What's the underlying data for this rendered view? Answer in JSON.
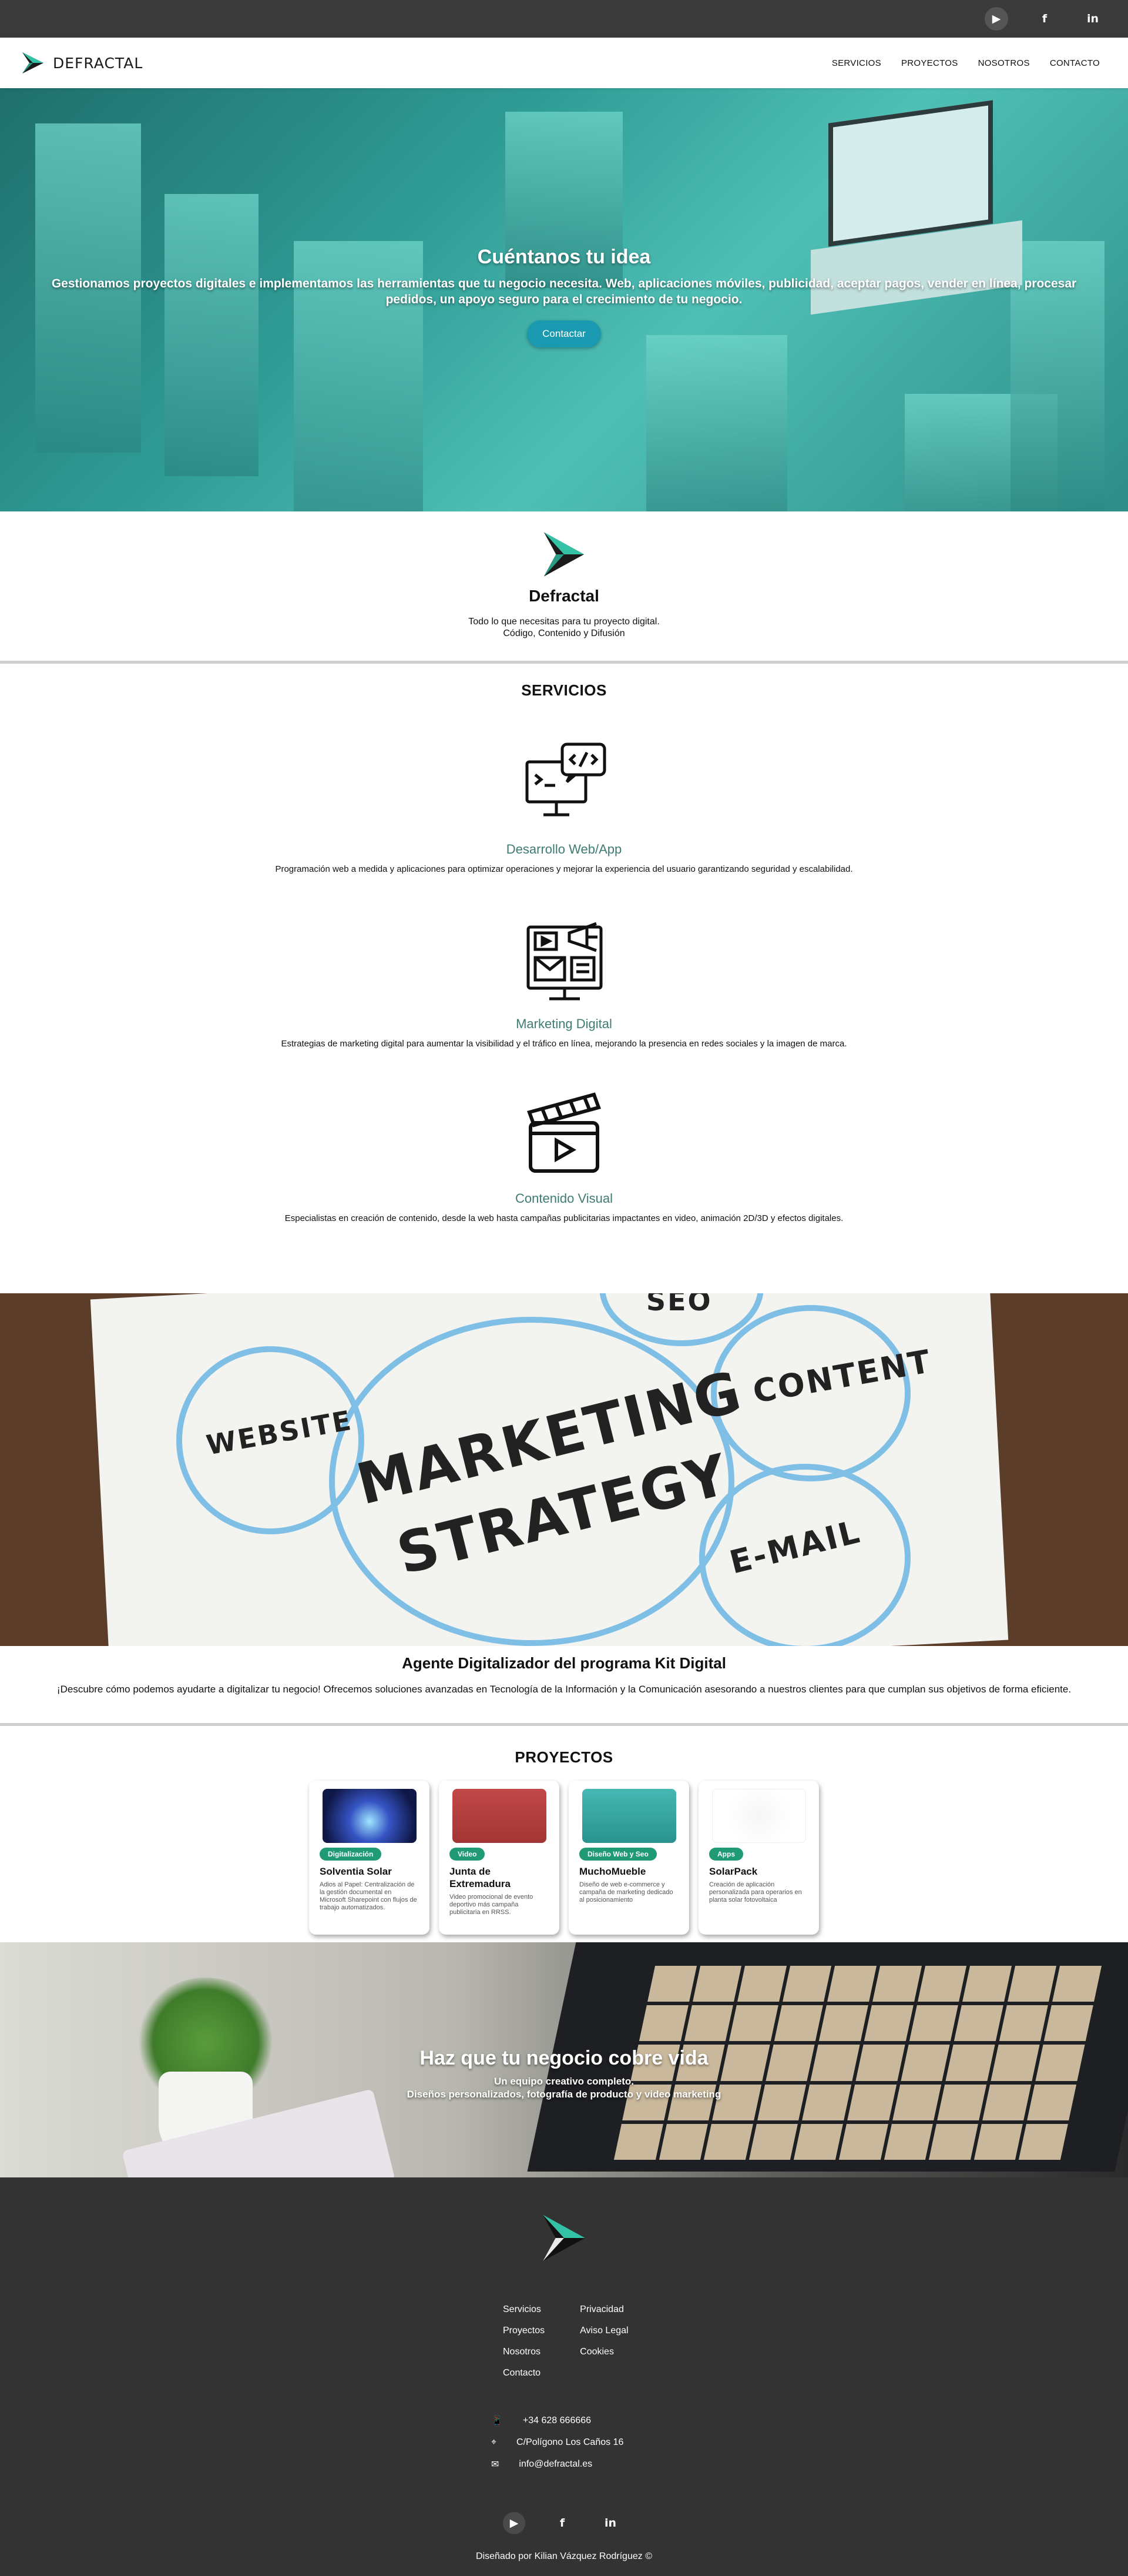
{
  "topbar": {
    "social": [
      "play-icon",
      "facebook-icon",
      "linkedin-icon"
    ]
  },
  "nav": {
    "brand": "DEFRACTAL",
    "items": [
      {
        "label": "SERVICIOS"
      },
      {
        "label": "PROYECTOS"
      },
      {
        "label": "NOSOTROS"
      },
      {
        "label": "CONTACTO"
      }
    ]
  },
  "hero": {
    "title": "Cuéntanos tu idea",
    "text": "Gestionamos proyectos digitales e implementamos las herramientas que tu negocio necesita. Web, aplicaciones móviles, publicidad, aceptar pagos, vender en línea, procesar pedidos, un apoyo seguro para el crecimiento de tu negocio.",
    "button": "Contactar"
  },
  "intro": {
    "name": "Defractal",
    "line1": "Todo lo que necesitas para tu proyecto digital.",
    "line2": "Código, Contenido y Difusión"
  },
  "services": {
    "title": "SERVICIOS",
    "items": [
      {
        "title": "Desarrollo Web/App",
        "desc": "Programación web a medida y aplicaciones para optimizar operaciones y mejorar la experiencia del usuario garantizando seguridad y escalabilidad.",
        "icon": "web-dev-icon"
      },
      {
        "title": "Marketing Digital",
        "desc": "Estrategias de marketing digital para aumentar la visibilidad y el tráfico en línea, mejorando la presencia en redes sociales y la imagen de marca.",
        "icon": "marketing-icon"
      },
      {
        "title": "Contenido Visual",
        "desc": "Especialistas en creación de contenido, desde la web hasta campañas publicitarias impactantes en video, animación 2D/3D y efectos digitales.",
        "icon": "clapperboard-icon"
      }
    ]
  },
  "marketing_image": {
    "words": [
      "WEBSITE",
      "SEO",
      "CONTENT",
      "MARKETING",
      "STRATEGY",
      "E-MAIL"
    ]
  },
  "agent": {
    "title": "Agente Digitalizador del programa Kit Digital",
    "text": "¡Descubre cómo podemos ayudarte a digitalizar tu negocio! Ofrecemos soluciones avanzadas en Tecnología de la Información y la Comunicación asesorando a nuestros clientes para que cumplan sus objetivos de forma eficiente."
  },
  "projects": {
    "title": "PROYECTOS",
    "cards": [
      {
        "badge": "Digitalización",
        "title": "Solventia Solar",
        "desc": "Adios al Papel: Centralización de la gestión documental en Microsoft Sharepoint con flujos de trabajo automatizados.",
        "color": "#1b2a6b"
      },
      {
        "badge": "Video",
        "title": "Junta de Extremadura",
        "desc": "Video promocional de evento deportivo más campaña publicitaria en RRSS.",
        "color": "#a93a3a"
      },
      {
        "badge": "Diseño Web y Seo",
        "title": "MuchoMueble",
        "desc": "Diseño de web e-commerce y campaña de marketing dedicado al posicionamiento",
        "color": "#38a8a6"
      },
      {
        "badge": "Apps",
        "title": "SolarPack",
        "desc": "Creación de aplicación personalizada para operarios en planta solar fotovoltaica",
        "color": "#ffffff"
      }
    ]
  },
  "hero2": {
    "title": "Haz que tu negocio cobre vida",
    "sub1": "Un equipo creativo completo.",
    "sub2": "Diseños personalizados, fotografía de producto y video marketing"
  },
  "footer": {
    "links_col1": [
      "Servicios",
      "Proyectos",
      "Nosotros",
      "Contacto"
    ],
    "links_col2": [
      "Privacidad",
      "Aviso Legal",
      "Cookies"
    ],
    "phone": "+34 628 666666",
    "address": "C/Polígono Los Caños 16",
    "email": "info@defractal.es",
    "copyright": "Diseñado por Kilian Vázquez Rodríguez ©"
  }
}
